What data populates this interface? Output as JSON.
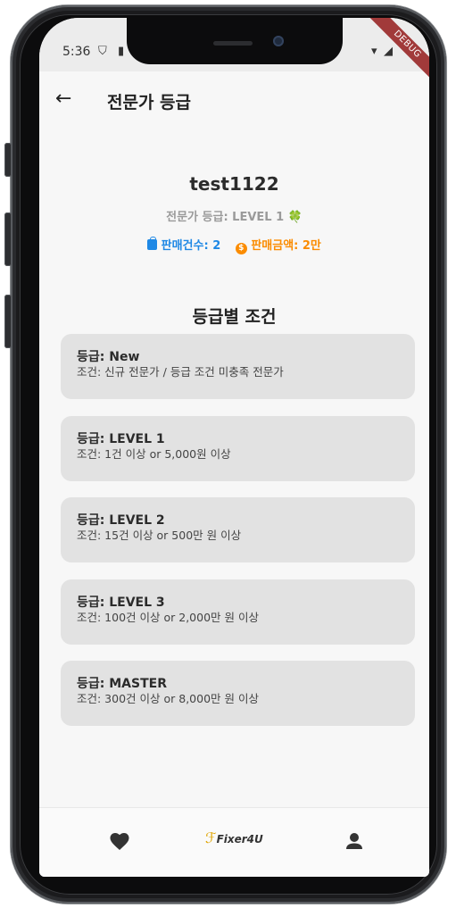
{
  "status": {
    "time": "5:36",
    "debug_label": "DEBUG"
  },
  "appbar": {
    "title": "전문가 등급"
  },
  "profile": {
    "username": "test1122",
    "grade_text": "전문가 등급: LEVEL 1 🍀",
    "sales_count": "판매건수: 2",
    "sales_amount": "판매금액: 2만"
  },
  "section_title": "등급별 조건",
  "levels": [
    {
      "title": "등급: New",
      "desc": "조건: 신규 전문가 / 등급 조건 미충족 전문가"
    },
    {
      "title": "등급: LEVEL 1",
      "desc": "조건: 1건 이상 or 5,000원 이상"
    },
    {
      "title": "등급: LEVEL 2",
      "desc": "조건: 15건 이상 or 500만 원 이상"
    },
    {
      "title": "등급: LEVEL 3",
      "desc": "조건: 100건 이상 or 2,000만 원 이상"
    },
    {
      "title": "등급: MASTER",
      "desc": "조건: 300건 이상 or 8,000만 원 이상"
    }
  ],
  "bottom_nav": {
    "logo_text": "Fixer4U"
  },
  "colors": {
    "blue": "#1e88e5",
    "orange": "#fb8c00",
    "card_bg": "#e2e2e2"
  }
}
